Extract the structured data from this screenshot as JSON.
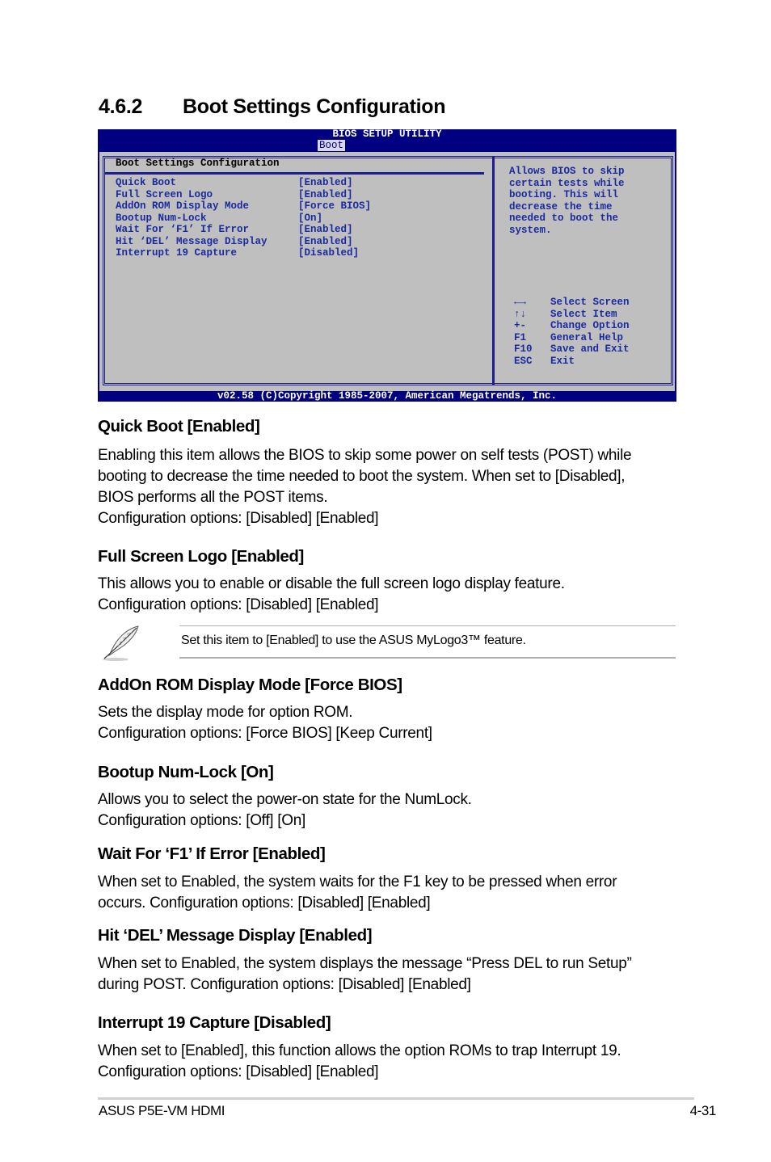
{
  "section": {
    "number": "4.6.2",
    "title": "Boot Settings Configuration"
  },
  "bios": {
    "title": "BIOS SETUP UTILITY",
    "active_tab": "Boot",
    "panel_heading": "Boot Settings Configuration",
    "items": [
      {
        "label": "Quick Boot",
        "value": "[Enabled]"
      },
      {
        "label": "Full Screen Logo",
        "value": "[Enabled]"
      },
      {
        "label": "AddOn ROM Display Mode",
        "value": "[Force BIOS]"
      },
      {
        "label": "Bootup Num-Lock",
        "value": "[On]"
      },
      {
        "label": "Wait For ‘F1’ If Error",
        "value": "[Enabled]"
      },
      {
        "label": "Hit ‘DEL’ Message Display",
        "value": "[Enabled]"
      },
      {
        "label": "Interrupt 19 Capture",
        "value": "[Disabled]"
      }
    ],
    "help_lines": [
      "Allows BIOS to skip",
      "certain tests while",
      "booting. This will",
      "decrease the time",
      "needed to boot the",
      "system."
    ],
    "keys": [
      {
        "key": "←→",
        "icon": "left-right-arrows-icon",
        "action": "Select Screen"
      },
      {
        "key": "↑↓",
        "icon": "up-down-arrows-icon",
        "action": "Select Item"
      },
      {
        "key": "+-",
        "action": "Change Option"
      },
      {
        "key": "F1",
        "action": "General Help"
      },
      {
        "key": "F10",
        "action": "Save and Exit"
      },
      {
        "key": "ESC",
        "action": "Exit"
      }
    ],
    "footer": "v02.58 (C)Copyright 1985-2007, American Megatrends, Inc."
  },
  "items": [
    {
      "heading": "Quick Boot [Enabled]",
      "lines": [
        "Enabling this item allows the BIOS to skip some power on self tests (POST) while",
        "booting to decrease the time needed to boot the system. When set to [Disabled],",
        "BIOS performs all the POST items.",
        "Configuration options: [Disabled] [Enabled]"
      ]
    },
    {
      "heading": "Full Screen Logo [Enabled]",
      "lines": [
        "This allows you to enable or disable the full screen logo display feature.",
        "Configuration options: [Disabled] [Enabled]"
      ]
    },
    {
      "heading": "AddOn ROM Display Mode [Force BIOS]",
      "lines": [
        "Sets the display mode for option ROM.",
        "Configuration options: [Force BIOS] [Keep Current]"
      ]
    },
    {
      "heading": "Bootup Num-Lock [On]",
      "lines": [
        "Allows you to select the power-on state for the NumLock.",
        "Configuration options: [Off] [On]"
      ]
    },
    {
      "heading": "Wait For ‘F1’ If Error [Enabled]",
      "lines": [
        "When set to Enabled, the system waits for the F1 key to be pressed when error",
        "occurs. Configuration options: [Disabled] [Enabled]"
      ]
    },
    {
      "heading": "Hit ‘DEL’ Message Display [Enabled]",
      "lines": [
        "When set to Enabled, the system displays the message “Press DEL to run Setup”",
        "during POST. Configuration options: [Disabled] [Enabled]"
      ]
    },
    {
      "heading": "Interrupt 19 Capture [Disabled]",
      "lines": [
        "When set to [Enabled], this function allows the option ROMs to trap Interrupt 19.",
        "Configuration options: [Disabled] [Enabled]"
      ]
    }
  ],
  "note": {
    "icon": "feather-pen-icon",
    "text": "Set this item to [Enabled] to use the ASUS MyLogo3™ feature."
  },
  "footer": {
    "left": "ASUS P5E-VM HDMI",
    "right": "4-31"
  }
}
